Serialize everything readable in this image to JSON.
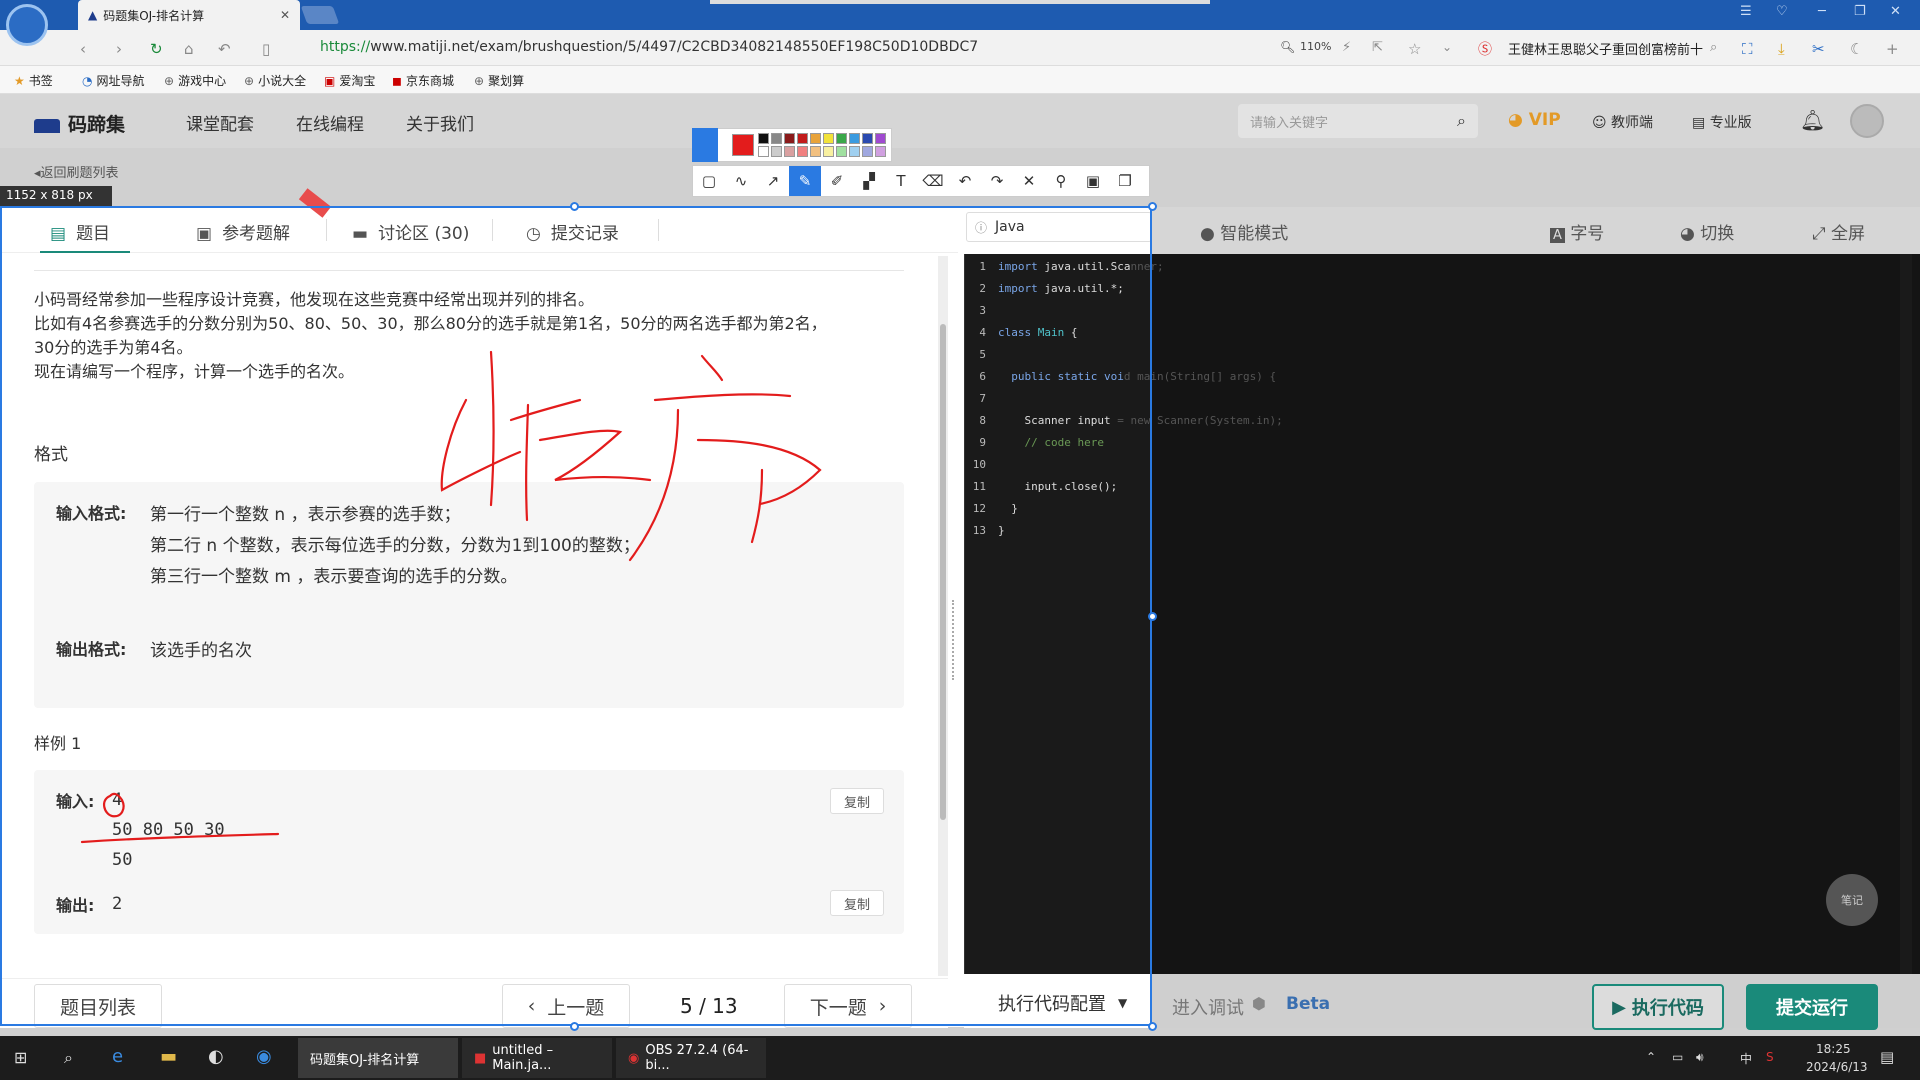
{
  "browser": {
    "tab_title": "码题集OJ-排名计算",
    "url_scheme": "https://",
    "url_rest": "www.matiji.net/exam/brushquestion/5/4497/C2CBD34082148550EF198C50D10DBDC7",
    "zoom": "110%",
    "news": "王健林王思聪父子重回创富榜前十"
  },
  "bookmarks": [
    "书签",
    "网址导航",
    "游戏中心",
    "小说大全",
    "爱淘宝",
    "京东商城",
    "聚划算"
  ],
  "site": {
    "logo": "码蹄集",
    "nav": [
      "课堂配套",
      "在线编程",
      "关于我们"
    ],
    "search_placeholder": "请输入关键字",
    "vip": "VIP",
    "teacher": "教师端",
    "pro": "专业版"
  },
  "back_link": "返回刷题列表",
  "dim_label": "1152 x 818  px",
  "tabs": {
    "problem": "题目",
    "solution": "参考题解",
    "discuss": "讨论区 (30)",
    "records": "提交记录"
  },
  "lang": "Java",
  "right_toolbar": {
    "smart": "智能模式",
    "font": "字号",
    "switch": "切换",
    "fullscreen": "全屏"
  },
  "problem": {
    "p1": "小码哥经常参加一些程序设计竞赛，他发现在这些竞赛中经常出现并列的排名。",
    "p2": "比如有4名参赛选手的分数分别为50、80、50、30，那么80分的选手就是第1名，50分的两名选手都为第2名，",
    "p3": "30分的选手为第4名。",
    "p4": "现在请编写一个程序，计算一个选手的名次。",
    "format_head": "格式",
    "input_label": "输入格式:",
    "input_l1": "第一行一个整数 n ，表示参赛的选手数；",
    "input_l2": "第二行 n 个整数，表示每位选手的分数，分数为1到100的整数；",
    "input_l3": "第三行一个整数 m ，表示要查询的选手的分数。",
    "output_label": "输出格式:",
    "output_text": "该选手的名次",
    "sample_head": "样例 1",
    "sample_in_label": "输入:",
    "sample_in_1": "4",
    "sample_in_2": "50 80 50 30",
    "sample_in_3": "50",
    "sample_out_label": "输出:",
    "sample_out": "2",
    "copy": "复制"
  },
  "bottom": {
    "list": "题目列表",
    "prev": "上一题",
    "page": "5 / 13",
    "next": "下一题",
    "exec_config": "执行代码配置"
  },
  "code_lines": [
    {
      "n": "1",
      "parts": [
        [
          "kw",
          "import "
        ],
        [
          "pl",
          "java.util.Sca"
        ]
      ],
      "dim": "nner;"
    },
    {
      "n": "2",
      "parts": [
        [
          "kw",
          "import "
        ],
        [
          "pl",
          "java.util.*;"
        ]
      ],
      "dim": ""
    },
    {
      "n": "3",
      "parts": [],
      "dim": ""
    },
    {
      "n": "4",
      "parts": [
        [
          "kw",
          "class "
        ],
        [
          "cls",
          "Main "
        ],
        [
          "pl",
          "{"
        ]
      ],
      "dim": ""
    },
    {
      "n": "5",
      "parts": [],
      "dim": ""
    },
    {
      "n": "6",
      "parts": [
        [
          "pl",
          "  "
        ],
        [
          "kw",
          "public static voi"
        ]
      ],
      "dim": "d main(String[] args) {"
    },
    {
      "n": "7",
      "parts": [],
      "dim": ""
    },
    {
      "n": "8",
      "parts": [
        [
          "pl",
          "    Scanner input"
        ]
      ],
      "dim": " = new Scanner(System.in);"
    },
    {
      "n": "9",
      "parts": [
        [
          "cm",
          "    // code here"
        ]
      ],
      "dim": ""
    },
    {
      "n": "10",
      "parts": [],
      "dim": ""
    },
    {
      "n": "11",
      "parts": [
        [
          "pl",
          "    input.close();"
        ]
      ],
      "dim": ""
    },
    {
      "n": "12",
      "parts": [
        [
          "pl",
          "  }"
        ]
      ],
      "dim": ""
    },
    {
      "n": "13",
      "parts": [
        [
          "pl",
          "}"
        ]
      ],
      "dim": ""
    }
  ],
  "actions": {
    "debug": "进入调试",
    "beta": "Beta",
    "run": "执行代码",
    "submit": "提交运行",
    "note": "笔记"
  },
  "taskbar": {
    "app1": "码题集OJ-排名计算",
    "app2": "untitled – Main.ja...",
    "app3": "OBS 27.2.4 (64-bi...",
    "ime": "中",
    "time": "18:25",
    "date": "2024/6/13"
  },
  "colors": {
    "accent": "#1a8a7a",
    "annot": "#e31c1c",
    "select": "#2a7ae2"
  }
}
